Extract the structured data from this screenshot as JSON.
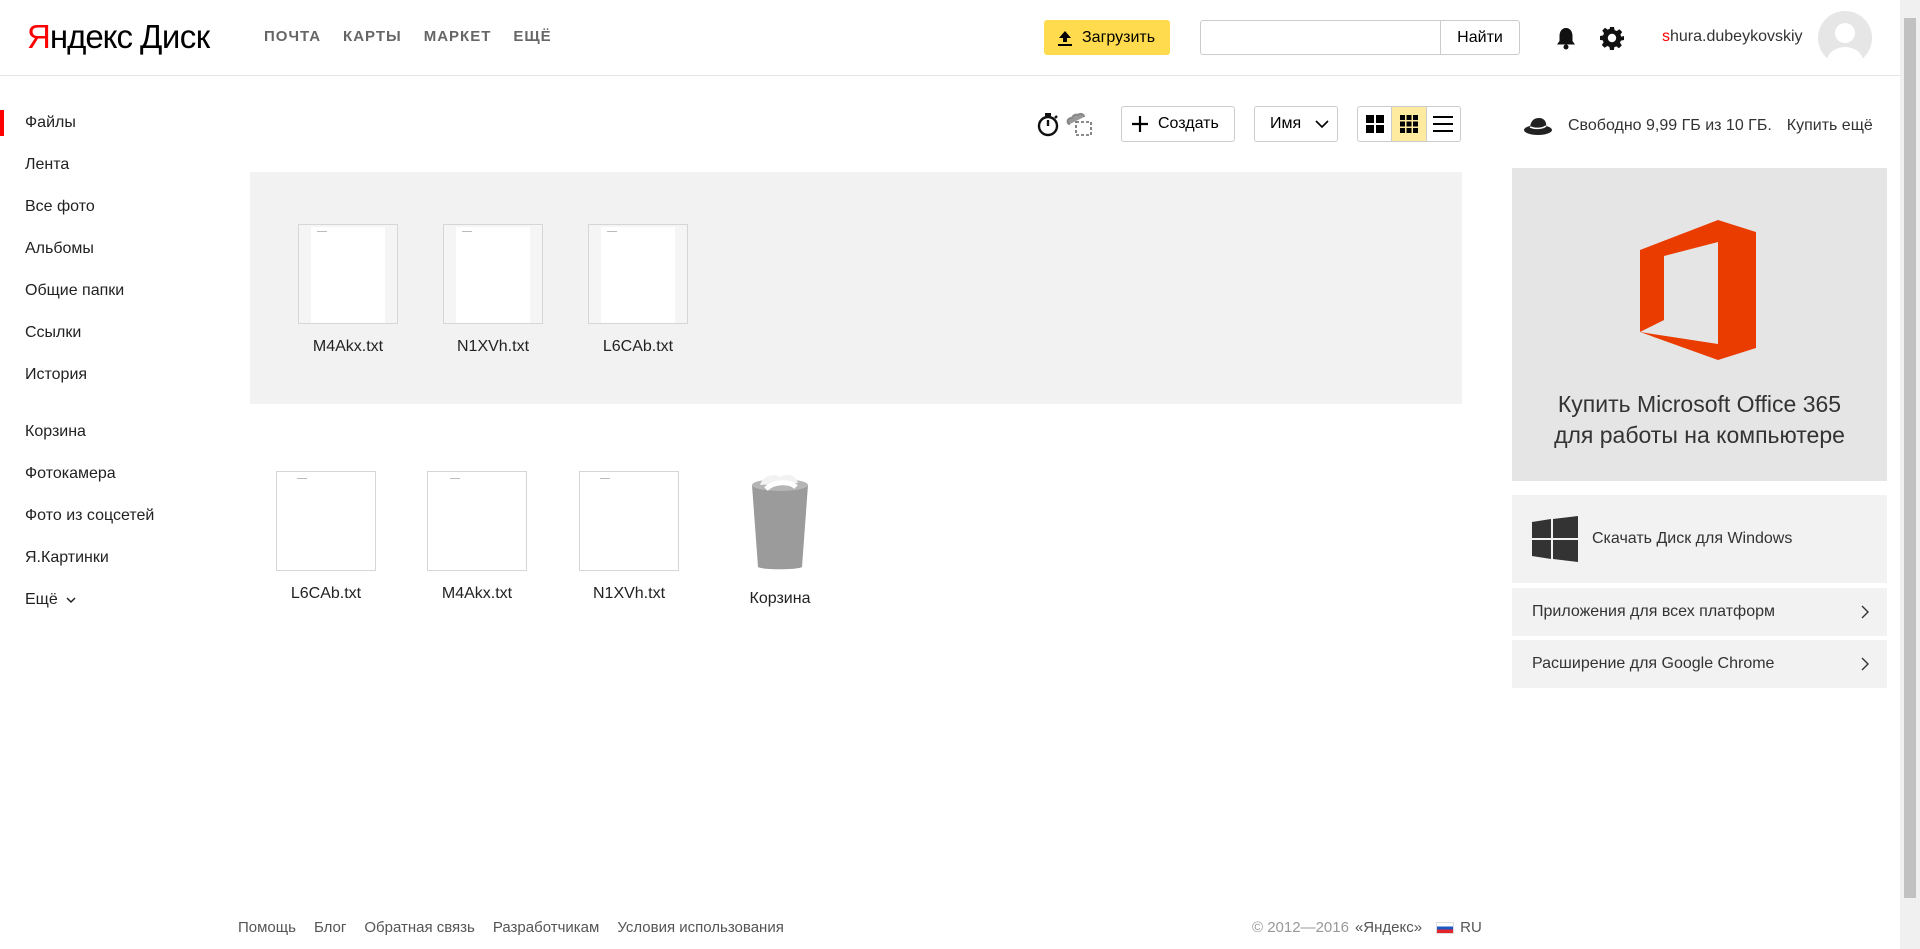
{
  "header": {
    "logo_yandex_first": "Я",
    "logo_yandex_rest": "ндекс",
    "logo_disk": "Диск",
    "nav": [
      "ПОЧТА",
      "КАРТЫ",
      "МАРКЕТ",
      "ЕЩЁ"
    ],
    "upload_label": "Загрузить",
    "search_placeholder": "",
    "search_button": "Найти",
    "username_first": "s",
    "username_rest": "hura.dubeykovskiy"
  },
  "sidebar": {
    "items": [
      "Файлы",
      "Лента",
      "Все фото",
      "Альбомы",
      "Общие папки",
      "Ссылки",
      "История"
    ],
    "items2": [
      "Корзина",
      "Фотокамера",
      "Фото из соцсетей",
      "Я.Картинки",
      "Ещё"
    ]
  },
  "toolbar": {
    "create_label": "Создать",
    "sort_label": "Имя",
    "space_text": "Свободно 9,99 ГБ из 10 ГБ.",
    "buy_more": "Купить ещё"
  },
  "files_selected": [
    "M4Akx.txt",
    "N1XVh.txt",
    "L6CAb.txt"
  ],
  "files": [
    "L6CAb.txt",
    "M4Akx.txt",
    "N1XVh.txt",
    "Корзина"
  ],
  "right_panel": {
    "promo_line1": "Купить Microsoft Office 365",
    "promo_line2": "для работы на компьютере",
    "download_windows": "Скачать Диск для Windows",
    "apps_all": "Приложения для всех платформ",
    "chrome_ext": "Расширение для Google Chrome",
    "office_color": "#eb3c00"
  },
  "footer": {
    "links": [
      "Помощь",
      "Блог",
      "Обратная связь",
      "Разработчикам",
      "Условия использования"
    ],
    "copyright": "© 2012—2016",
    "yandex": "«Яндекс»",
    "lang": "RU"
  }
}
